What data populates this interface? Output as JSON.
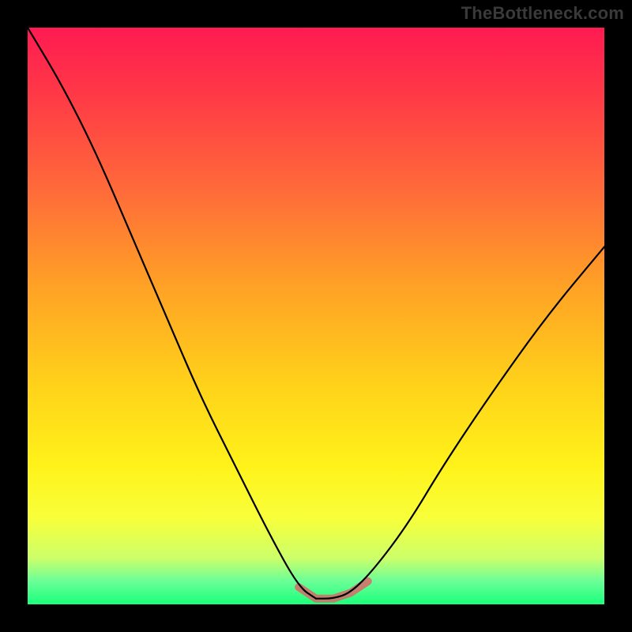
{
  "watermark": {
    "text": "TheBottleneck.com"
  },
  "plot": {
    "gradient_colors": [
      "#ff1a52",
      "#ff3a46",
      "#ff6a3a",
      "#ffa225",
      "#ffd21a",
      "#fff21a",
      "#f8ff3a",
      "#ccff6a",
      "#6aff98",
      "#1aff7a"
    ],
    "curve_color": "#000000",
    "valley_highlight_color": "#d86a6a"
  },
  "chart_data": {
    "type": "line",
    "title": "",
    "xlabel": "",
    "ylabel": "",
    "xlim": [
      0,
      100
    ],
    "ylim": [
      0,
      100
    ],
    "grid": false,
    "note": "Single V-shaped bottleneck curve; minimum/optimal region highlighted. No numeric axes printed in source image, values below estimated from position.",
    "series": [
      {
        "name": "bottleneck-curve",
        "x": [
          0,
          6,
          12,
          18,
          24,
          30,
          36,
          42,
          47,
          50,
          53,
          56,
          60,
          66,
          72,
          80,
          90,
          100
        ],
        "y": [
          100,
          90,
          78,
          64,
          50,
          36,
          24,
          12,
          3,
          1,
          1,
          2,
          6,
          14,
          24,
          36,
          50,
          62
        ]
      },
      {
        "name": "optimal-region-highlight",
        "x": [
          47,
          50,
          53,
          56,
          59
        ],
        "y": [
          3,
          1,
          1,
          2,
          4
        ]
      }
    ]
  }
}
